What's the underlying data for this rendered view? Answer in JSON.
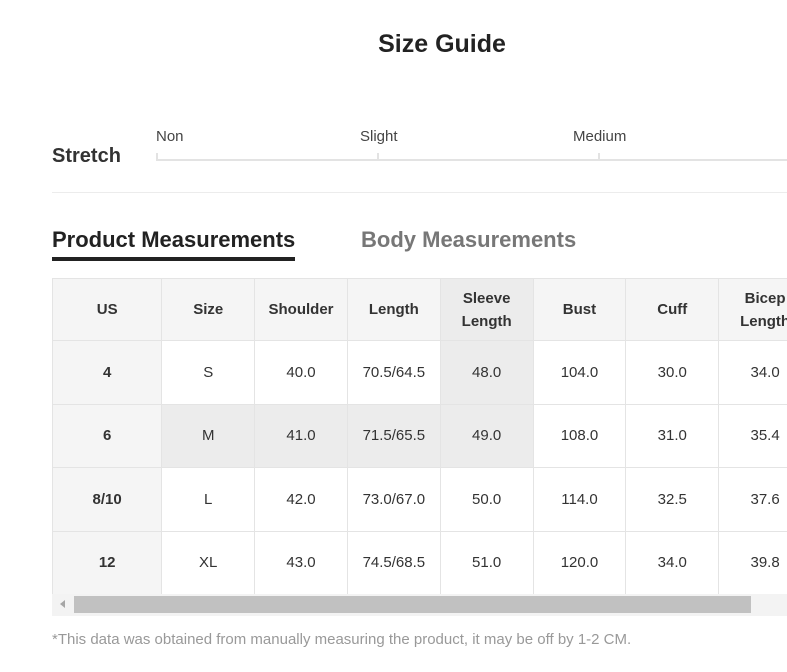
{
  "title": "Size Guide",
  "stretch": {
    "label": "Stretch",
    "options": [
      "Non",
      "Slight",
      "Medium"
    ]
  },
  "tabs": {
    "product": "Product Measurements",
    "body": "Body Measurements",
    "active": "product"
  },
  "table": {
    "headers": [
      "US",
      "Size",
      "Shoulder",
      "Length",
      [
        "Sleeve",
        "Length"
      ],
      "Bust",
      "Cuff",
      [
        "Bicep",
        "Length"
      ]
    ],
    "rows": [
      [
        "4",
        "S",
        "40.0",
        "70.5/64.5",
        "48.0",
        "104.0",
        "30.0",
        "34.0"
      ],
      [
        "6",
        "M",
        "41.0",
        "71.5/65.5",
        "49.0",
        "108.0",
        "31.0",
        "35.4"
      ],
      [
        "8/10",
        "L",
        "42.0",
        "73.0/67.0",
        "50.0",
        "114.0",
        "32.5",
        "37.6"
      ],
      [
        "12",
        "XL",
        "43.0",
        "74.5/68.5",
        "51.0",
        "120.0",
        "34.0",
        "39.8"
      ]
    ]
  },
  "note": "*This data was obtained from manually measuring the product, it may be off by 1-2 CM."
}
